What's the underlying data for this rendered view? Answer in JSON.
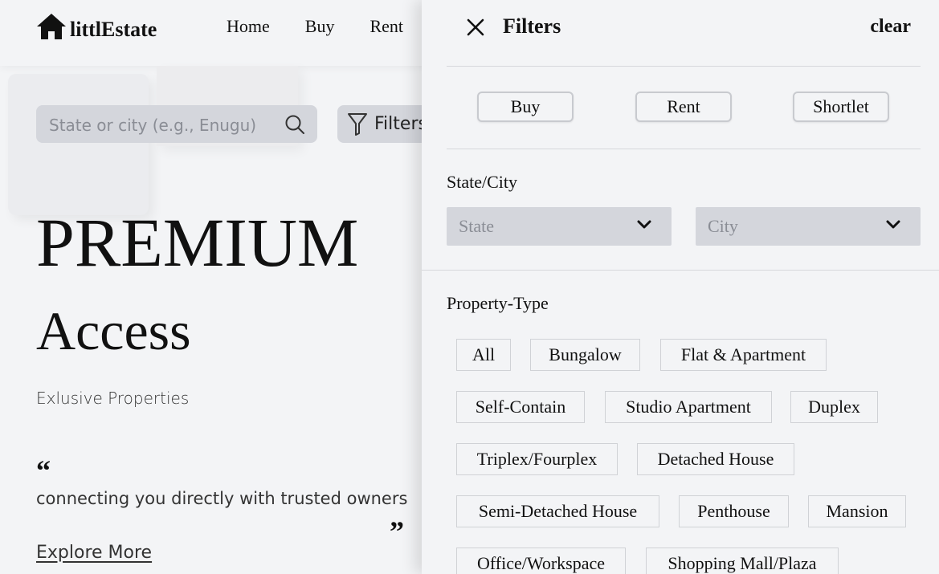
{
  "brand": {
    "name": "littlEstate"
  },
  "nav": {
    "items": [
      "Home",
      "Buy",
      "Rent"
    ]
  },
  "search": {
    "placeholder": "State or city (e.g., Enugu)"
  },
  "filters_button": {
    "label": "Filters"
  },
  "hero": {
    "title": "PREMIUM",
    "subtitle": "Access",
    "tagline": "Exlusive Properties",
    "quote_open": "“",
    "quote": "connecting you directly with trusted owners",
    "quote_close": "”",
    "cta": "Explore More"
  },
  "panel": {
    "title": "Filters",
    "clear_label": "clear",
    "listing_types": [
      "Buy",
      "Rent",
      "Shortlet"
    ],
    "location": {
      "label": "State/City",
      "state_placeholder": "State",
      "city_placeholder": "City"
    },
    "property_type": {
      "label": "Property-Type",
      "options": [
        "All",
        "Bungalow",
        "Flat & Apartment",
        "Self-Contain",
        "Studio Apartment",
        "Duplex",
        "Triplex/Fourplex",
        "Detached House",
        "Semi-Detached House",
        "Penthouse",
        "Mansion",
        "Office/Workspace",
        "Shopping Mall/Plaza"
      ]
    }
  }
}
